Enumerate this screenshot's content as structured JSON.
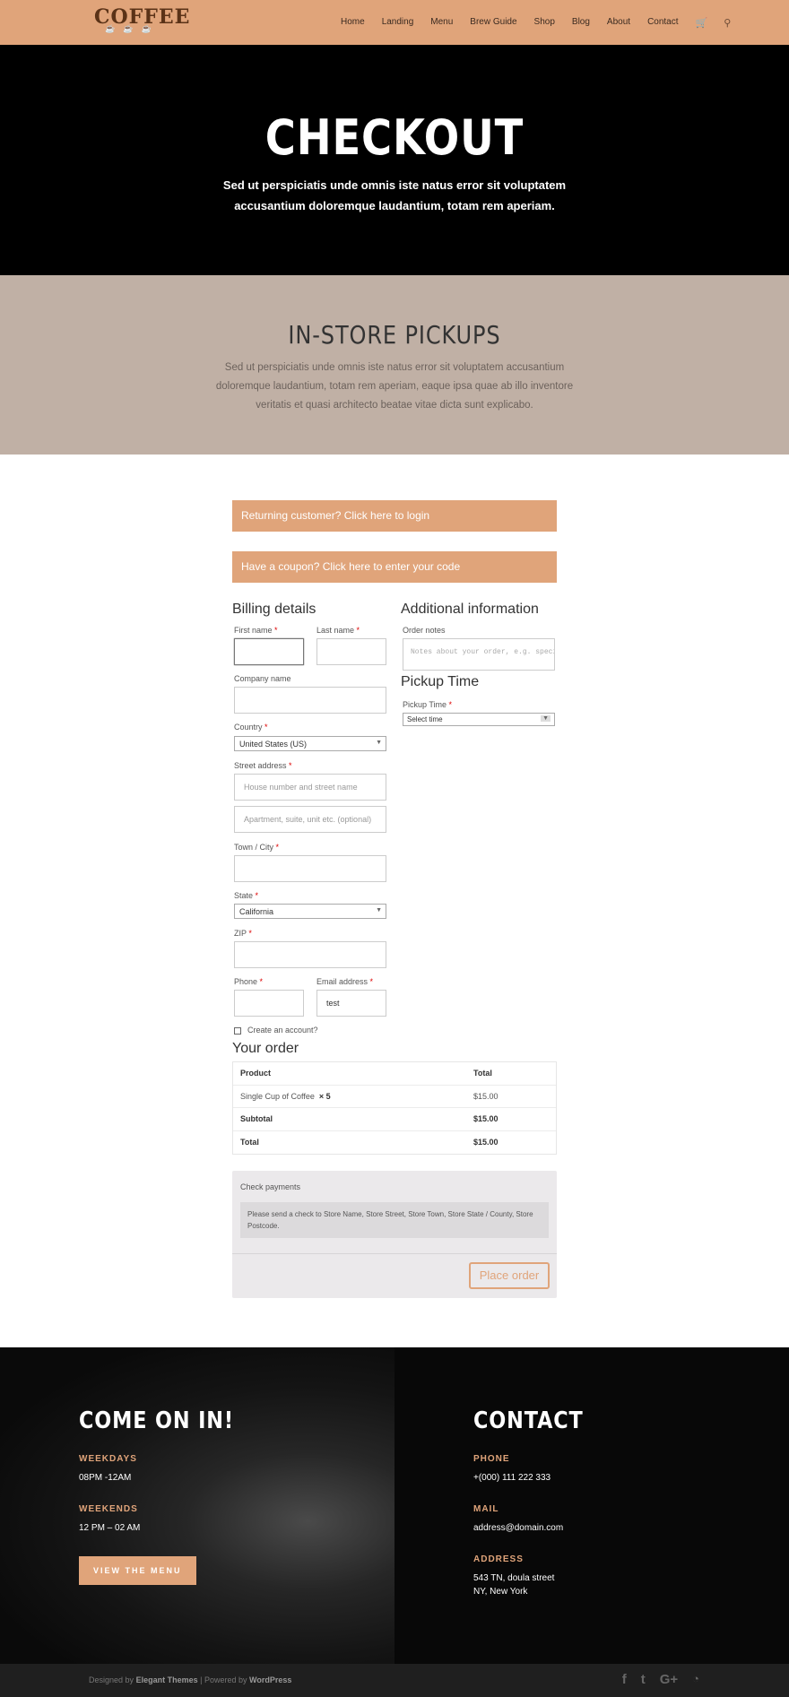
{
  "header": {
    "logo": "COFFEE",
    "logo_sub": "☕ ☕ ☕",
    "nav": [
      "Home",
      "Landing",
      "Menu",
      "Brew Guide",
      "Shop",
      "Blog",
      "About",
      "Contact"
    ],
    "cart_icon": "🛒",
    "search_icon": "⚲"
  },
  "hero": {
    "title": "CHECKOUT",
    "text": "Sed ut perspiciatis unde omnis iste natus error sit voluptatem accusantium doloremque laudantium, totam rem aperiam."
  },
  "pickups": {
    "title": "IN-STORE PICKUPS",
    "text": "Sed ut perspiciatis unde omnis iste natus error sit voluptatem accusantium doloremque laudantium, totam rem aperiam, eaque ipsa quae ab illo inventore veritatis et quasi architecto beatae vitae dicta sunt explicabo."
  },
  "notices": {
    "login": "Returning customer? Click here to login",
    "coupon": "Have a coupon? Click here to enter your code"
  },
  "billing": {
    "title": "Billing details",
    "first_name": "First name",
    "last_name": "Last name",
    "company": "Company name",
    "country": "Country",
    "country_value": "United States (US)",
    "street": "Street address",
    "street_placeholder": "House number and street name",
    "street2_placeholder": "Apartment, suite, unit etc. (optional)",
    "town": "Town / City",
    "state": "State",
    "state_value": "California",
    "zip": "ZIP",
    "phone": "Phone",
    "email": "Email address",
    "email_value": "test",
    "create_account": "Create an account?",
    "required": "*"
  },
  "additional": {
    "title": "Additional information",
    "notes_label": "Order notes",
    "notes_placeholder": "Notes about your order, e.g. special notes for delivery.",
    "pickup_title": "Pickup Time",
    "pickup_label": "Pickup Time",
    "pickup_value": "Select time"
  },
  "order": {
    "title": "Your order",
    "head_product": "Product",
    "head_total": "Total",
    "item_name": "Single Cup of Coffee",
    "item_qty": "× 5",
    "item_total": "$15.00",
    "subtotal_label": "Subtotal",
    "subtotal_value": "$15.00",
    "total_label": "Total",
    "total_value": "$15.00"
  },
  "payment": {
    "method": "Check payments",
    "description": "Please send a check to Store Name, Store Street, Store Town, Store State / County, Store Postcode.",
    "button": "Place order"
  },
  "footer": {
    "left_title": "COME ON IN!",
    "weekdays_label": "WEEKDAYS",
    "weekdays_value": "08PM -12AM",
    "weekends_label": "WEEKENDS",
    "weekends_value": "12 PM – 02 AM",
    "menu_button": "VIEW THE MENU",
    "right_title": "CONTACT",
    "phone_label": "PHONE",
    "phone_value": "+(000) 111 222 333",
    "mail_label": "MAIL",
    "mail_value": "address@domain.com",
    "address_label": "ADDRESS",
    "address_line1": "543 TN, doula street",
    "address_line2": "NY, New York"
  },
  "bottom": {
    "designed_by": "Designed by",
    "elegant": "Elegant Themes",
    "powered_by": "| Powered by",
    "wordpress": "WordPress",
    "social": [
      "f",
      "t",
      "G+",
      "rss"
    ]
  },
  "colors": {
    "accent": "#e0a47a",
    "hero_bg": "#000000",
    "pickup_bg": "#c0b0a5"
  }
}
